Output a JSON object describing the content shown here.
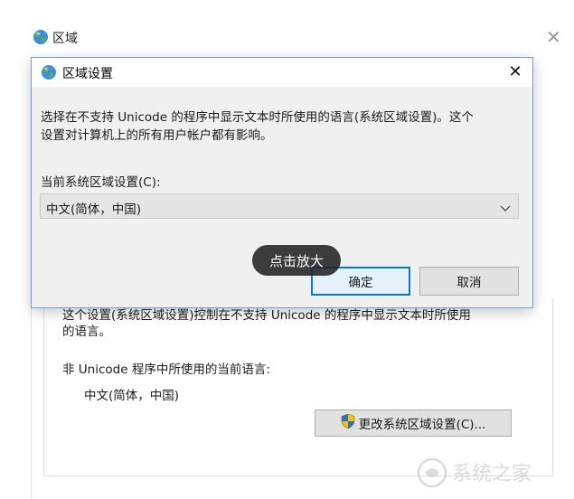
{
  "background_window": {
    "title": "区域",
    "hidden_text_line1": "这个设置(系统区域设置)控制在不支持 Unicode 的程序中显示文本时所使用",
    "hidden_text_line2": "的语言。",
    "non_unicode_label": "非 Unicode 程序中所使用的当前语言:",
    "non_unicode_value": "中文(简体，中国)",
    "change_button_label": "更改系统区域设置(C)..."
  },
  "dialog": {
    "title": "区域设置",
    "description_line1": "选择在不支持 Unicode 的程序中显示文本时所使用的语言(系统区域设置)。这个",
    "description_line2": "设置对计算机上的所有用户帐户都有影响。",
    "current_label": "当前系统区域设置(C):",
    "current_value": "中文(简体，中国)",
    "ok_label": "确定",
    "cancel_label": "取消"
  },
  "overlay": {
    "zoom_label": "点击放大"
  },
  "watermark": {
    "text": "系统之家"
  },
  "colors": {
    "accent": "#0078d7",
    "dialog_border": "#6c9ecf",
    "dialog_bg": "#f0f0f0"
  },
  "icons": [
    "globe-icon",
    "close-icon",
    "chevron-down-icon",
    "shield-icon"
  ]
}
